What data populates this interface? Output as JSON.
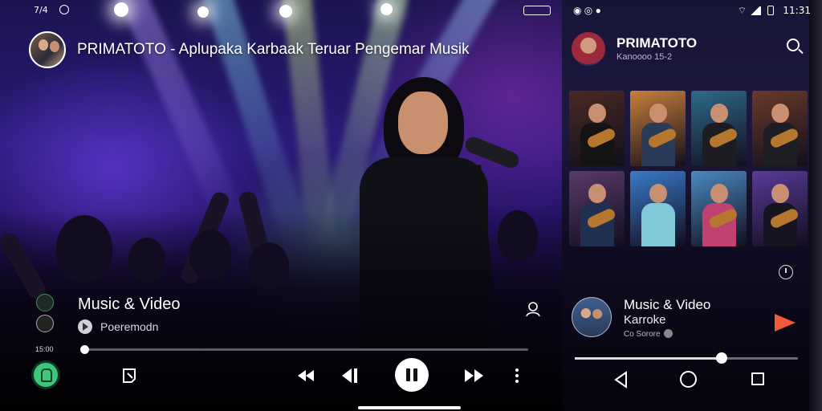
{
  "left_player": {
    "status_bar": {
      "time": "7/4"
    },
    "header": {
      "title": "PRIMATOTO - Aplupaka Karbaak Teruar Pengemar Musik"
    },
    "now_playing": {
      "title": "Music & Video",
      "subtitle": "Poeremodn"
    },
    "progress": {
      "elapsed_label": "15:00",
      "fraction": 0.01
    },
    "controls": [
      "app-icon",
      "playlist-icon",
      "rewind-icon",
      "previous-icon",
      "pause-icon",
      "fast-forward-icon",
      "more-icon"
    ]
  },
  "right_phone": {
    "status_bar": {
      "time": "11:31"
    },
    "header": {
      "title": "PRIMATOTO",
      "subtitle": "Kanoooo 15-2"
    },
    "thumbnails": [
      {
        "name": "singer-tuxedo",
        "bg": "#4a2a22",
        "torso": "#141414"
      },
      {
        "name": "duo-guitars",
        "bg": "#c9803a",
        "torso": "#2c3a5a"
      },
      {
        "name": "stage-singer",
        "bg": "#2f6a8a",
        "torso": "#1c1c22"
      },
      {
        "name": "guitarist-sunset",
        "bg": "#6a3a2a",
        "torso": "#1d1d24"
      },
      {
        "name": "band-stage",
        "bg": "#5a3a6a",
        "torso": "#203050"
      },
      {
        "name": "karaoke-card",
        "bg": "#3a7ac9",
        "torso": "#7fc9d8"
      },
      {
        "name": "beach-guitarist",
        "bg": "#4a8ac0",
        "torso": "#c04070"
      },
      {
        "name": "purple-guitarist",
        "bg": "#5a3a9a",
        "torso": "#161420"
      }
    ],
    "now_playing": {
      "title": "Music & Video",
      "subtitle": "Karroke",
      "meta": "Co Sorore"
    },
    "progress": {
      "fraction": 0.66
    }
  },
  "colors": {
    "accent_green": "#3cc77a",
    "play_orange": "#f05a3a"
  }
}
